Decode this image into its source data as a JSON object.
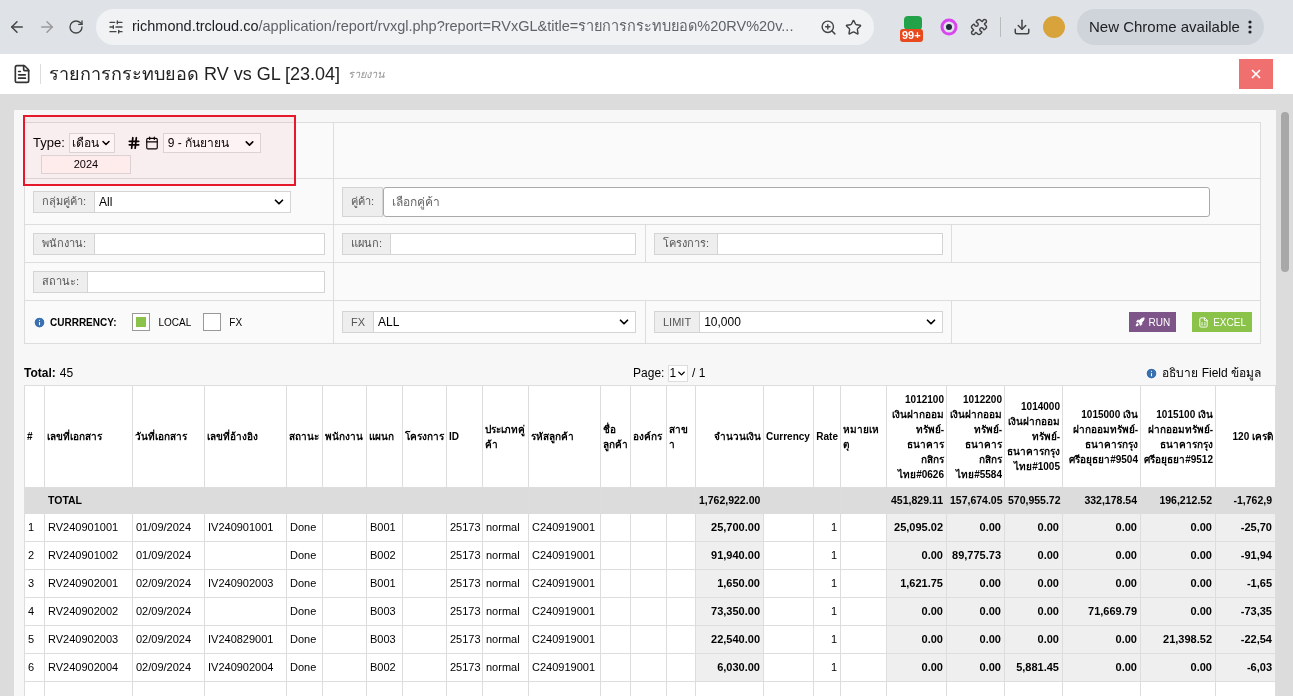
{
  "browser": {
    "url_host": "richmond.trcloud.co",
    "url_path": "/application/report/rvxgl.php?report=RVxGL&title=รายการกระทบยอด%20RV%20v...",
    "badge": "99+",
    "update_button": "New Chrome available"
  },
  "page": {
    "title": "รายการกระทบยอด RV vs GL [23.04]",
    "subtitle": "รายงาน"
  },
  "filters": {
    "type_label": "Type:",
    "type_value": "เดือน",
    "month": "9 - กันยายน",
    "year": "2024",
    "customer_group": {
      "label": "กลุ่มคู่ค้า:",
      "value": "All"
    },
    "customer": {
      "label": "คู่ค้า:",
      "placeholder": "เลือกคู่ค้า"
    },
    "employee": {
      "label": "พนักงาน:"
    },
    "department": {
      "label": "แผนก:"
    },
    "project": {
      "label": "โครงการ:"
    },
    "status": {
      "label": "สถานะ:"
    },
    "currency": {
      "label": "CURRRENCY:",
      "options": [
        {
          "label": "LOCAL",
          "checked": true
        },
        {
          "label": "FX",
          "checked": false
        }
      ]
    },
    "fx": {
      "label": "FX",
      "value": "ALL"
    },
    "limit": {
      "label": "LIMIT",
      "value": "10,000"
    },
    "run_button": "RUN",
    "excel_button": "EXCEL"
  },
  "summary": {
    "total_label": "Total:",
    "total_value": "45",
    "page_label": "Page:",
    "page_value": "1",
    "page_total": "/ 1",
    "field_help": "อธิบาย Field ข้อมูล"
  },
  "table": {
    "columns": [
      {
        "label": "#",
        "kind": "text"
      },
      {
        "label": "เลขที่เอกสาร",
        "kind": "text"
      },
      {
        "label": "วันที่เอกสาร",
        "kind": "text"
      },
      {
        "label": "เลขที่อ้างอิง",
        "kind": "text"
      },
      {
        "label": "สถานะ",
        "kind": "text"
      },
      {
        "label": "พนักงาน",
        "kind": "text"
      },
      {
        "label": "แผนก",
        "kind": "text"
      },
      {
        "label": "โครงการ",
        "kind": "text"
      },
      {
        "label": "ID",
        "kind": "text"
      },
      {
        "label": "ประเภทคู่ค้า",
        "kind": "text"
      },
      {
        "label": "รหัสลูกค้า",
        "kind": "text"
      },
      {
        "label": "ชื่อลูกค้า",
        "kind": "text"
      },
      {
        "label": "องค์กร",
        "kind": "text"
      },
      {
        "label": "สาขา",
        "kind": "text"
      },
      {
        "label": "จำนวนเงิน",
        "kind": "amount"
      },
      {
        "label": "Currency",
        "kind": "text"
      },
      {
        "label": "Rate",
        "kind": "number"
      },
      {
        "label": "หมายเหตุ",
        "kind": "text"
      },
      {
        "label": "1012100 เงินฝากออมทรัพย์-ธนาคารกสิกรไทย#0626",
        "kind": "amount"
      },
      {
        "label": "1012200 เงินฝากออมทรัพย์-ธนาคารกสิกรไทย#5584",
        "kind": "amount"
      },
      {
        "label": "1014000 เงินฝากออมทรัพย์-ธนาคารกรุงไทย#1005",
        "kind": "amount"
      },
      {
        "label": "1015000 เงินฝากออมทรัพย์-ธนาคารกรุงศรีอยุธยา#9504",
        "kind": "amount"
      },
      {
        "label": "1015100 เงินฝากออมทรัพย์-ธนาคารกรุงศรีอยุธยา#9512",
        "kind": "amount"
      },
      {
        "label": "120 เครดิ",
        "kind": "amount"
      }
    ],
    "total_row": {
      "label": "TOTAL",
      "amount": "1,762,922.00",
      "accounts": [
        "451,829.11",
        "157,674.05",
        "570,955.72",
        "332,178.54",
        "196,212.52",
        "-1,762,9"
      ]
    },
    "rows": [
      {
        "no": "1",
        "doc_no": "RV240901001",
        "doc_date": "01/09/2024",
        "ref_no": "IV240901001",
        "status": "Done",
        "department": "B001",
        "id": "25173",
        "customer_type": "normal",
        "customer_code": "C240919001",
        "amount": "25,700.00",
        "rate": "1",
        "accounts": [
          "25,095.02",
          "0.00",
          "0.00",
          "0.00",
          "0.00",
          "-25,70"
        ]
      },
      {
        "no": "2",
        "doc_no": "RV240901002",
        "doc_date": "01/09/2024",
        "status": "Done",
        "department": "B002",
        "id": "25173",
        "customer_type": "normal",
        "customer_code": "C240919001",
        "amount": "91,940.00",
        "rate": "1",
        "accounts": [
          "0.00",
          "89,775.73",
          "0.00",
          "0.00",
          "0.00",
          "-91,94"
        ]
      },
      {
        "no": "3",
        "doc_no": "RV240902001",
        "doc_date": "02/09/2024",
        "ref_no": "IV240902003",
        "status": "Done",
        "department": "B001",
        "id": "25173",
        "customer_type": "normal",
        "customer_code": "C240919001",
        "amount": "1,650.00",
        "rate": "1",
        "accounts": [
          "1,621.75",
          "0.00",
          "0.00",
          "0.00",
          "0.00",
          "-1,65"
        ]
      },
      {
        "no": "4",
        "doc_no": "RV240902002",
        "doc_date": "02/09/2024",
        "status": "Done",
        "department": "B003",
        "id": "25173",
        "customer_type": "normal",
        "customer_code": "C240919001",
        "amount": "73,350.00",
        "rate": "1",
        "accounts": [
          "0.00",
          "0.00",
          "0.00",
          "71,669.79",
          "0.00",
          "-73,35"
        ]
      },
      {
        "no": "5",
        "doc_no": "RV240902003",
        "doc_date": "02/09/2024",
        "ref_no": "IV240829001",
        "status": "Done",
        "department": "B003",
        "id": "25173",
        "customer_type": "normal",
        "customer_code": "C240919001",
        "amount": "22,540.00",
        "rate": "1",
        "accounts": [
          "0.00",
          "0.00",
          "0.00",
          "0.00",
          "21,398.52",
          "-22,54"
        ]
      },
      {
        "no": "6",
        "doc_no": "RV240902004",
        "doc_date": "02/09/2024",
        "ref_no": "IV240902004",
        "status": "Done",
        "department": "B002",
        "id": "25173",
        "customer_type": "normal",
        "customer_code": "C240919001",
        "amount": "6,030.00",
        "rate": "1",
        "accounts": [
          "0.00",
          "0.00",
          "5,881.45",
          "0.00",
          "0.00",
          "-6,03"
        ]
      }
    ]
  }
}
